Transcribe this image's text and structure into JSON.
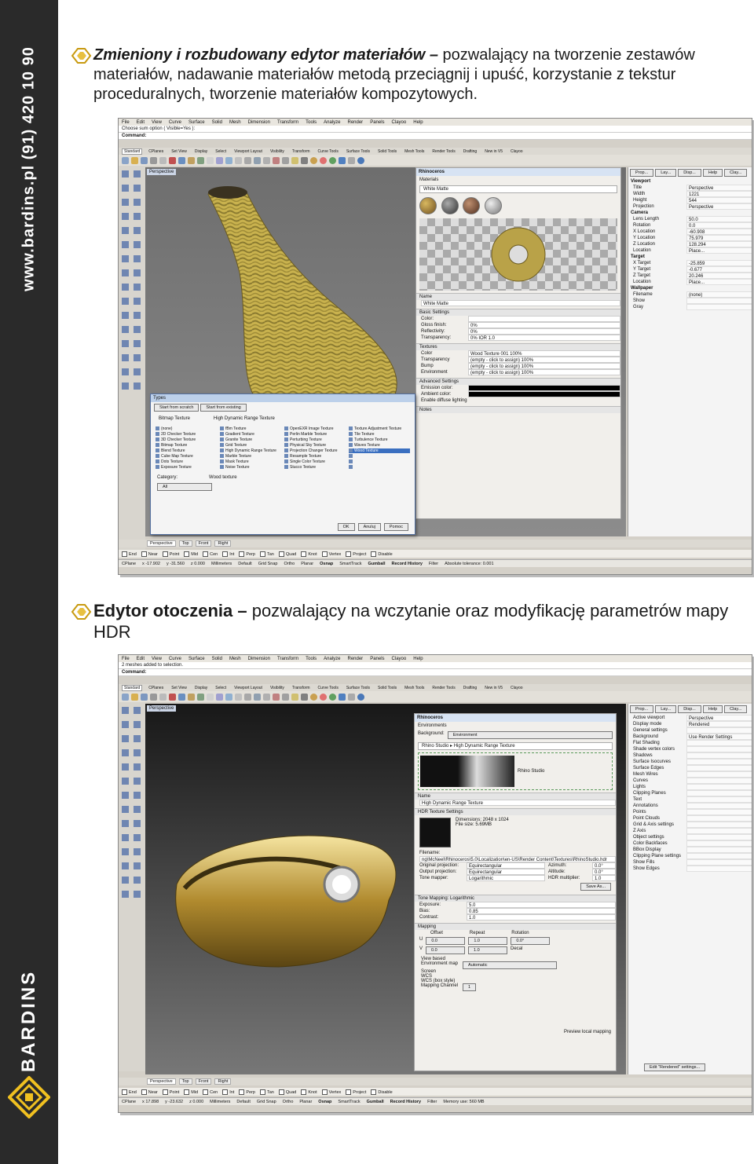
{
  "sidebar": {
    "vertical_text": "www.bardins.pl  (91) 420 10 90",
    "brand": "BARDINS"
  },
  "section1": {
    "bold": "Zmieniony i rozbudowany edytor materiałów –",
    "text": " pozwalający na tworzenie zestawów materiałów, nadawanie materiałów metodą przeciągnij i upuść, korzystanie z tekstur proceduralnych, tworzenie materiałów kompozytowych."
  },
  "section2": {
    "bold": "Edytor otoczenia –",
    "text": " pozwalający na wczytanie oraz modyfikację parametrów mapy HDR"
  },
  "rhino": {
    "menu": [
      "File",
      "Edit",
      "View",
      "Curve",
      "Surface",
      "Solid",
      "Mesh",
      "Dimension",
      "Transform",
      "Tools",
      "Analyze",
      "Render",
      "Panels",
      "Clayoo",
      "Help"
    ],
    "tabs": [
      "Standard",
      "CPlanes",
      "Set View",
      "Display",
      "Select",
      "Viewport Layout",
      "Visibility",
      "Transform",
      "Curve Tools",
      "Surface Tools",
      "Solid Tools",
      "Mesh Tools",
      "Render Tools",
      "Drafting",
      "New in V5",
      "Clayoo"
    ],
    "viewport_tabs": [
      "Perspective",
      "Top",
      "Front",
      "Right"
    ],
    "osnaps": [
      "End",
      "Near",
      "Point",
      "Mid",
      "Cen",
      "Int",
      "Perp",
      "Tan",
      "Quad",
      "Knot",
      "Vertex",
      "Project",
      "Disable"
    ],
    "status": [
      "Grid Snap",
      "Ortho",
      "Planar",
      "Osnap",
      "SmartTrack",
      "Gumball",
      "Record History",
      "Filter"
    ]
  },
  "shot1": {
    "cmd1": "Choose sum option ( Visible=Yes ):",
    "cmd2": "Command:",
    "viewport_label": "Perspective",
    "panel_title": "Rhinoceros",
    "panel_sub": "Materials",
    "material_selected": "White Matte",
    "name_label": "Name",
    "name_value": "White Matte",
    "basic_settings": "Basic Settings",
    "basic_rows": [
      {
        "k": "Color:",
        "v": ""
      },
      {
        "k": "Gloss finish:",
        "v": "0%"
      },
      {
        "k": "Reflectivity:",
        "v": "0%"
      },
      {
        "k": "Transparency:",
        "v": "0%  IOR 1.0"
      }
    ],
    "textures": "Textures",
    "texture_rows": [
      {
        "k": "Color",
        "v": "Wood Texture 001   100%"
      },
      {
        "k": "Transparency",
        "v": "(empty - click to assign)   100%"
      },
      {
        "k": "Bump",
        "v": "(empty - click to assign)   100%"
      },
      {
        "k": "Environment",
        "v": "(empty - click to assign)   100%"
      }
    ],
    "advanced": "Advanced Settings",
    "advanced_rows": [
      {
        "k": "Emission color:",
        "v": ""
      },
      {
        "k": "Ambient color:",
        "v": ""
      }
    ],
    "diffuse_lighting": "Enable diffuse lighting",
    "notes": "Notes",
    "props_tabs": [
      "Prop...",
      "Lay...",
      "Disp...",
      "Help",
      "Clay..."
    ],
    "props_sections": [
      {
        "title": "Viewport",
        "rows": [
          [
            "Title",
            "Perspective"
          ],
          [
            "Width",
            "1221"
          ],
          [
            "Height",
            "544"
          ],
          [
            "Projection",
            "Perspective"
          ]
        ]
      },
      {
        "title": "Camera",
        "rows": [
          [
            "Lens Length",
            "50.0"
          ],
          [
            "Rotation",
            "0.0"
          ],
          [
            "X Location",
            "-60.908"
          ],
          [
            "Y Location",
            "75.979"
          ],
          [
            "Z Location",
            "128.294"
          ],
          [
            "Location",
            "Place..."
          ]
        ]
      },
      {
        "title": "Target",
        "rows": [
          [
            "X Target",
            "-25.859"
          ],
          [
            "Y Target",
            "-0.677"
          ],
          [
            "Z Target",
            "20.246"
          ],
          [
            "Location",
            "Place..."
          ]
        ]
      },
      {
        "title": "Wallpaper",
        "rows": [
          [
            "Filename",
            "(none)"
          ],
          [
            "Show",
            ""
          ],
          [
            "Gray",
            ""
          ]
        ]
      }
    ],
    "dialog": {
      "title": "Types",
      "tab1": "Start from scratch",
      "tab2": "Start from existing",
      "opt1": "Bitmap Texture",
      "opt2": "High Dynamic Range Texture",
      "types": [
        "(none)",
        "2D Checker Texture",
        "3D Checker Texture",
        "Bitmap Texture",
        "Blend Texture",
        "Cube Map Texture",
        "Dots Texture",
        "Exposure Texture",
        "fBm Texture",
        "Gradient Texture",
        "Granite Texture",
        "Grid Texture",
        "High Dynamic Range Texture",
        "Marble Texture",
        "Mask Texture",
        "Noise Texture",
        "OpenEXR Image Texture",
        "Perlin Marble Texture",
        "Perturbing Texture",
        "Physical Sky Texture",
        "Projection Changer Texture",
        "Resample Texture",
        "Single Color Texture",
        "Stucco Texture",
        "Texture Adjustment Texture",
        "Tile Texture",
        "Turbulence Texture",
        "Waves Texture",
        "Wood Texture"
      ],
      "category_label": "Category:",
      "category_value": "All",
      "desc": "Wood texture",
      "ok": "OK",
      "cancel": "Anuluj",
      "help": "Pomoc"
    },
    "coords": {
      "cplane": "CPlane",
      "x": "x -17.902",
      "y": "y -31.560",
      "z": "z 0.000",
      "units": "Millimeters",
      "layer": "Default",
      "tolerance": "Absolute tolerance: 0.001"
    }
  },
  "shot2": {
    "cmd1": "2 meshes added to selection.",
    "cmd2": "Command:",
    "viewport_label": "Perspective",
    "panel_title": "Rhinoceros",
    "panel_sub": "Environments",
    "background_label": "Background:",
    "background_value": "Environment",
    "breadcrumb": "Rhino Studio  ▸  High Dynamic Range Texture",
    "thumb_label": "Rhino Studio",
    "name_label": "Name",
    "name_value": "High Dynamic Range Texture",
    "hdr_section": "HDR Texture Settings",
    "dimensions": "Dimensions: 2048 x 1024",
    "file_size": "File size: 5.69MB",
    "filename_label": "Filename:",
    "filename_value": "ng\\McNeel\\Rhinoceros\\5.0\\Localization\\en-US\\Render Content\\Textures\\RhinoStudio.hdr",
    "hdr_rows": [
      {
        "k": "Original projection:",
        "v": "Equirectangular",
        "k2": "Azimuth:",
        "v2": "0.0°"
      },
      {
        "k": "Output projection:",
        "v": "Equirectangular",
        "k2": "Altitude:",
        "v2": "0.0°"
      },
      {
        "k": "Tone mapper:",
        "v": "Logarithmic",
        "k2": "HDR multiplier:",
        "v2": "1.0"
      }
    ],
    "save_as": "Save As...",
    "tone_section": "Tone Mapping: Logarithmic",
    "tone_rows": [
      {
        "k": "Exposure:",
        "v": "5.0"
      },
      {
        "k": "Bias:",
        "v": "0.85"
      },
      {
        "k": "Contrast:",
        "v": "1.0"
      }
    ],
    "mapping_section": "Mapping",
    "mapping_head": [
      "Offset",
      "Repeat",
      "Rotation"
    ],
    "mapping_u": [
      "U",
      "0.0",
      "1.0",
      "0.0°"
    ],
    "mapping_v": [
      "V",
      "0.0",
      "1.0"
    ],
    "decal": "Decal",
    "mapping_opts": [
      "View based",
      "Environment map",
      "Screen",
      "WCS",
      "WCS (box style)",
      "Mapping Channel"
    ],
    "env_map_value": "Automatic",
    "mapping_channel": "1",
    "preview_local": "Preview local mapping",
    "props_tabs": [
      "Prop...",
      "Lay...",
      "Disp...",
      "Help",
      "Clay..."
    ],
    "props_rows": [
      [
        "Active viewport",
        "Perspective"
      ],
      [
        "Display mode",
        "Rendered"
      ],
      [
        "General settings",
        ""
      ],
      [
        "Background",
        "Use Render Settings"
      ],
      [
        "Flat Shading",
        ""
      ],
      [
        "Shade vertex colors",
        ""
      ],
      [
        "Shadows",
        ""
      ],
      [
        "Surface Isocurves",
        ""
      ],
      [
        "Surface Edges",
        ""
      ],
      [
        "Mesh Wires",
        ""
      ],
      [
        "Curves",
        ""
      ],
      [
        "Lights",
        ""
      ],
      [
        "Clipping Planes",
        ""
      ],
      [
        "Text",
        ""
      ],
      [
        "Annotations",
        ""
      ],
      [
        "Points",
        ""
      ],
      [
        "Point Clouds",
        ""
      ],
      [
        "Grid & Axis settings",
        ""
      ],
      [
        "Z Axis",
        ""
      ],
      [
        "Object settings",
        ""
      ],
      [
        "Color Backfaces",
        ""
      ],
      [
        "BBox Display",
        ""
      ],
      [
        "Clipping Plane settings",
        ""
      ],
      [
        "Show Fills",
        ""
      ],
      [
        "Show Edges",
        ""
      ]
    ],
    "edit_btn": "Edit \"Rendered\" settings...",
    "coords": {
      "cplane": "CPlane",
      "x": "x 17.898",
      "y": "y -23.632",
      "z": "z 0.000",
      "units": "Millimeters",
      "layer": "Default",
      "memory": "Memory use: 560 MB"
    }
  }
}
